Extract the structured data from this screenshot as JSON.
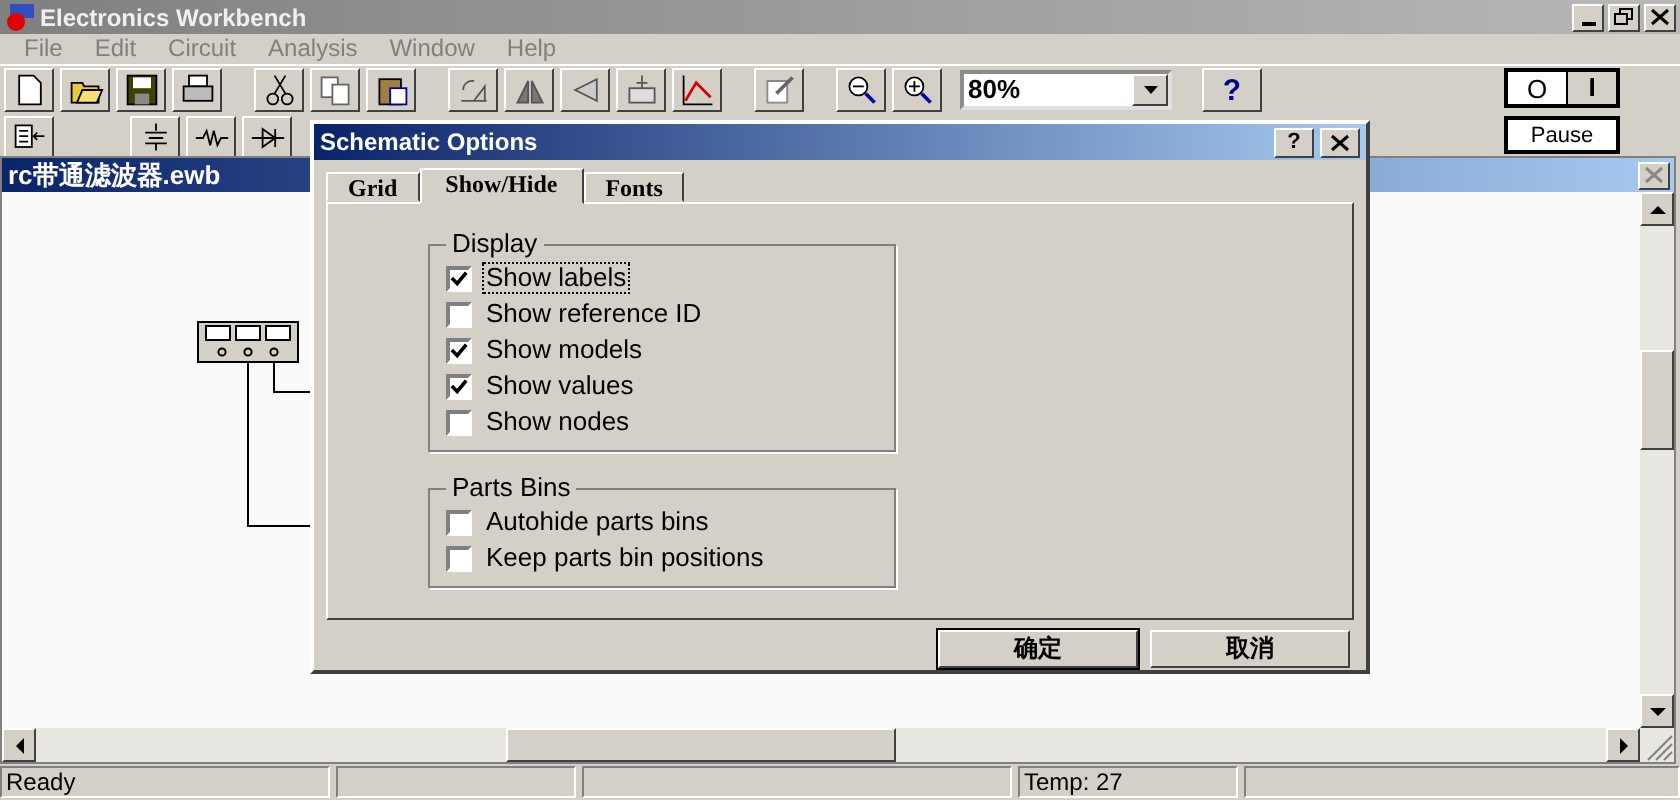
{
  "window": {
    "title": "Electronics Workbench"
  },
  "menu": [
    "File",
    "Edit",
    "Circuit",
    "Analysis",
    "Window",
    "Help"
  ],
  "toolbar": {
    "zoom": "80%",
    "help": "?"
  },
  "power_switch": {
    "off": "O",
    "on": "I"
  },
  "pause": "Pause",
  "document": {
    "title": "rc带通滤波器.ewb"
  },
  "dialog": {
    "title": "Schematic Options",
    "help": "?",
    "tabs": [
      {
        "label": "Grid",
        "selected": false
      },
      {
        "label": "Show/Hide",
        "selected": true
      },
      {
        "label": "Fonts",
        "selected": false
      }
    ],
    "groups": [
      {
        "title": "Display",
        "options": [
          {
            "label": "Show labels",
            "checked": true,
            "focused": true
          },
          {
            "label": "Show reference ID",
            "checked": false,
            "focused": false
          },
          {
            "label": "Show models",
            "checked": true,
            "focused": false
          },
          {
            "label": "Show values",
            "checked": true,
            "focused": false
          },
          {
            "label": "Show nodes",
            "checked": false,
            "focused": false
          }
        ]
      },
      {
        "title": "Parts Bins",
        "options": [
          {
            "label": "Autohide parts bins",
            "checked": false,
            "focused": false
          },
          {
            "label": "Keep parts bin positions",
            "checked": false,
            "focused": false
          }
        ]
      }
    ],
    "buttons": [
      {
        "label": "确定",
        "default": true
      },
      {
        "label": "取消",
        "default": false
      }
    ]
  },
  "status_bar": {
    "message": "Ready",
    "temperature": "Temp: 27"
  }
}
